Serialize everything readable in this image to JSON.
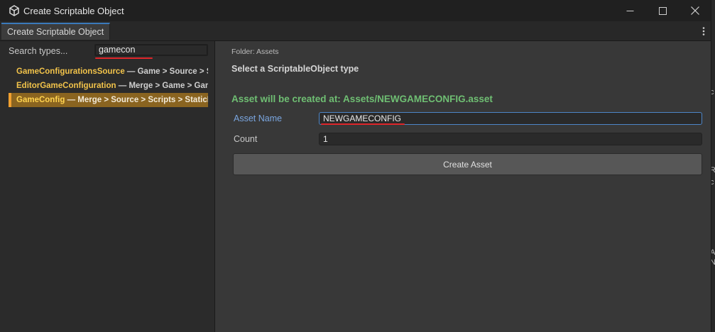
{
  "window": {
    "title": "Create Scriptable Object",
    "tab_label": "Create Scriptable Object"
  },
  "search": {
    "label": "Search types...",
    "value": "gamecon"
  },
  "results": [
    {
      "name": "GameConfigurationsSource",
      "path": " — Game > Source > Scripts"
    },
    {
      "name": "EditorGameConfiguration",
      "path": " — Merge > Game > Game"
    },
    {
      "name": "GameConfig",
      "path": " — Merge > Source > Scripts > StaticData",
      "selected": true
    }
  ],
  "main": {
    "folder_label": "Folder: Assets",
    "select_label": "Select a ScriptableObject type",
    "asset_path_text": "Asset will be created at: Assets/NEWGAMECONFIG.asset",
    "asset_name_label": "Asset Name",
    "asset_name_value": "NEWGAMECONFIG",
    "count_label": "Count",
    "count_value": "1",
    "create_button_label": "Create Asset"
  },
  "background_letters": [
    "R",
    "c",
    "A",
    "\\",
    "A",
    "N"
  ],
  "colors": {
    "accent_tab": "#3a79bb",
    "selection_bg": "#8a6420",
    "selection_bar": "#f0a030",
    "type_name": "#f2c34a",
    "asset_path_green": "#6fbf73",
    "active_label_blue": "#7aa6e0",
    "highlight_underline_red": "#e0262a"
  }
}
